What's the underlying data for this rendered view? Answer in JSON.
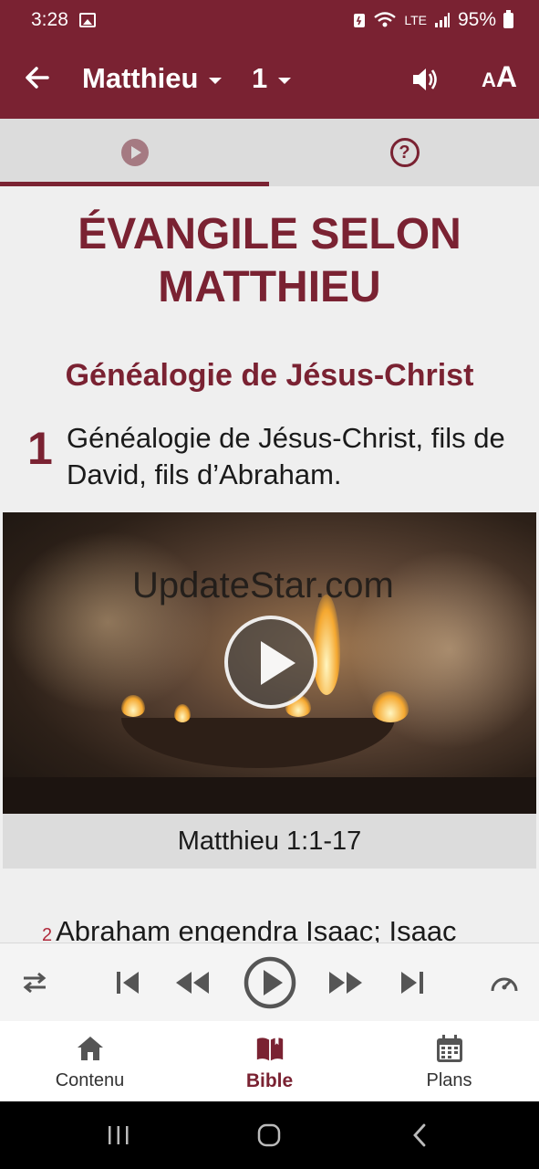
{
  "status_bar": {
    "time": "3:28",
    "network": "LTE",
    "battery": "95%"
  },
  "app_bar": {
    "book": "Matthieu",
    "chapter": "1",
    "text_size_small": "A",
    "text_size_large": "A"
  },
  "tabs": [
    {
      "icon": "play-circle-icon",
      "active": true
    },
    {
      "icon": "help-icon",
      "active": false
    }
  ],
  "content": {
    "book_title": "ÉVANGILE SELON MATTHIEU",
    "section_heading": "Généalogie de Jésus-Christ",
    "chapter_number": "1",
    "verse1_text": "Généalogie de Jésus-Christ, fils de David, fils d’Abraham.",
    "video": {
      "watermark": "UpdateStar.com",
      "caption": "Matthieu 1:1-17"
    },
    "verse2_number": "2",
    "verse2_text": "Abraham engendra Isaac; Isaac"
  },
  "player": {
    "buttons": [
      "repeat-icon",
      "skip-previous-icon",
      "rewind-icon",
      "play-icon",
      "fast-forward-icon",
      "skip-next-icon",
      "speed-icon"
    ]
  },
  "bottom_nav": {
    "items": [
      {
        "label": "Contenu",
        "icon": "home-icon",
        "active": false
      },
      {
        "label": "Bible",
        "icon": "book-icon",
        "active": true
      },
      {
        "label": "Plans",
        "icon": "calendar-icon",
        "active": false
      }
    ]
  },
  "colors": {
    "brand": "#7a2232",
    "background": "#efefef"
  }
}
